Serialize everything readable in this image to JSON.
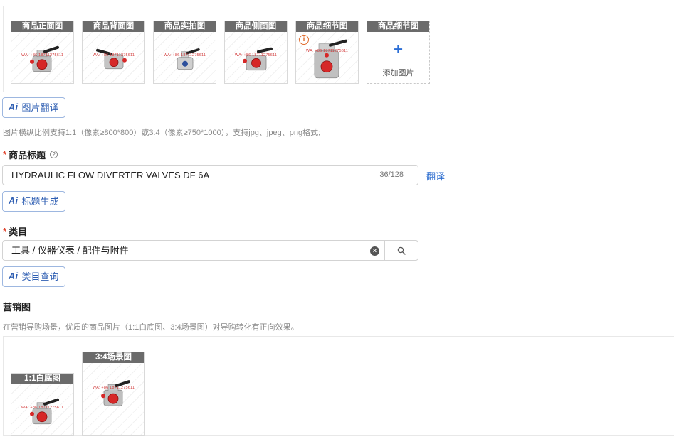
{
  "images": {
    "tiles": [
      {
        "label": "商品正面图",
        "watermark": "WA: +86 18711275611",
        "warning": false
      },
      {
        "label": "商品背面图",
        "watermark": "WA: +86 18711275611",
        "warning": false
      },
      {
        "label": "商品实拍图",
        "watermark": "WA: +86 18711275611",
        "warning": false
      },
      {
        "label": "商品侧面图",
        "watermark": "WA: +86 18711275611",
        "warning": false
      },
      {
        "label": "商品细节图",
        "watermark": "WA: +86 18711275611",
        "warning": true
      }
    ],
    "add_tile": {
      "label": "商品细节图",
      "plus": "+",
      "text": "添加图片"
    },
    "warning_glyph": "i"
  },
  "ai_buttons": {
    "mark": "Ai",
    "image_translate": "图片翻译",
    "title_generate": "标题生成",
    "category_query": "类目查询"
  },
  "image_hint": "图片横纵比例支持1:1（像素≥800*800）或3:4（像素≥750*1000），支持jpg、jpeg、png格式;",
  "title_field": {
    "required_mark": "*",
    "label": "商品标题",
    "help_glyph": "?",
    "value": "HYDRAULIC FLOW DIVERTER VALVES DF 6A",
    "counter": "36/128",
    "translate": "翻译"
  },
  "category_field": {
    "required_mark": "*",
    "label": "类目",
    "value": "工具 / 仪器仪表 / 配件与附件",
    "clear_glyph": "×"
  },
  "marketing": {
    "title": "营销图",
    "hint": "在营销导购场景，优质的商品图片（1:1白底图、3:4场景图）对导购转化有正向效果。",
    "tiles": [
      {
        "label": "1:1白底图",
        "watermark": "WA: +86 18711275611"
      },
      {
        "label": "3:4场景图",
        "watermark": "WA: +86 18711275611"
      }
    ]
  },
  "colors": {
    "accent": "#2f6fd0",
    "label_bg": "#6b6b6b",
    "required": "#e0452f",
    "warning": "#e06a2a"
  }
}
